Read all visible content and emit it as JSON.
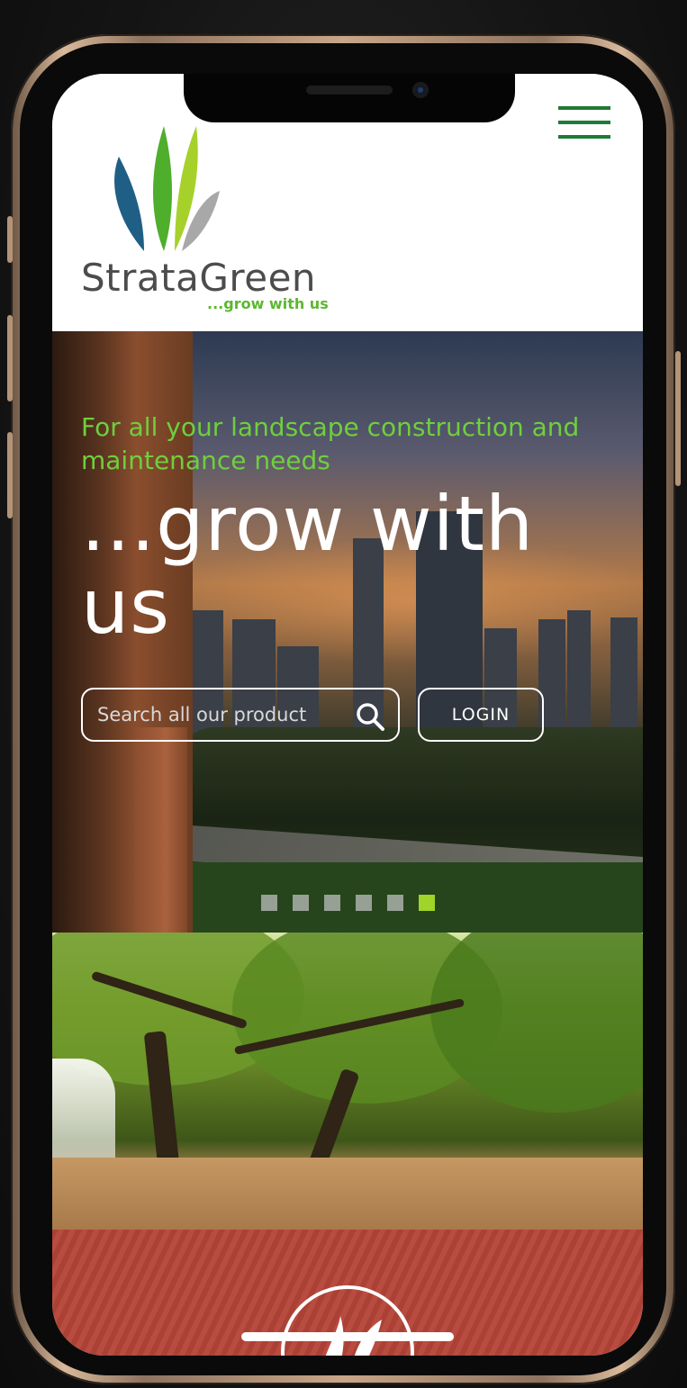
{
  "brand": {
    "name": "StrataGreen",
    "tagline": "...grow with us",
    "colors": {
      "primary": "#1f7a33",
      "accent": "#6fcf3e",
      "leaf_blue": "#1f5f86",
      "leaf_gray": "#a8a8a8",
      "promo_red": "#b64538"
    }
  },
  "header": {
    "menu_icon": "hamburger-menu-icon"
  },
  "hero": {
    "subtitle": "For all your landscape construction and maintenance needs",
    "title": "...grow with us",
    "search": {
      "placeholder": "Search all our product",
      "icon": "search-icon"
    },
    "login_label": "LOGIN",
    "slides": {
      "count": 6,
      "active_index": 5
    }
  }
}
